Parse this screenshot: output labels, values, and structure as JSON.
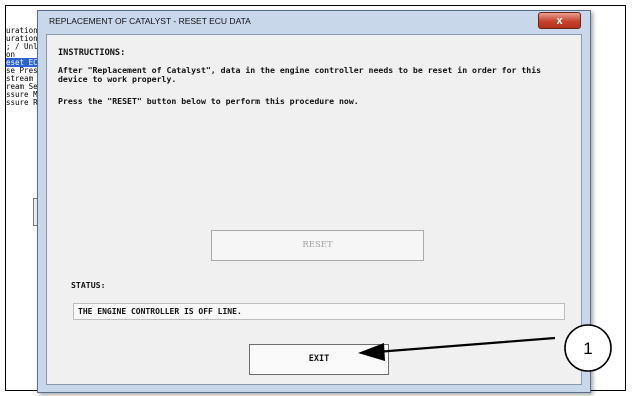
{
  "background_app": {
    "list_items": [
      "uration",
      "uration",
      "; / Unl",
      "on",
      "eset EC",
      "se Pres",
      "stream",
      "ream Se",
      "ssure M",
      "ssure R"
    ],
    "selected_index": 4
  },
  "dialog": {
    "title": "REPLACEMENT OF CATALYST - RESET ECU DATA",
    "close_label": "x",
    "instructions_heading": "INSTRUCTIONS:",
    "instructions_paragraph": "After \"Replacement of Catalyst\", data in the engine controller needs to be reset in order for this device to work properly.",
    "instructions_prompt": "Press the \"RESET\" button below to perform this procedure now.",
    "reset_label": "RESET",
    "status_label": "STATUS:",
    "status_value": "THE ENGINE CONTROLLER IS OFF LINE.",
    "exit_label": "EXIT"
  },
  "callout": {
    "number": "1"
  },
  "colors": {
    "dialog_frame": "#c8d7ea",
    "client_bg": "#f0f0f0",
    "close_button": "#c7432b",
    "selection": "#2b62d8"
  }
}
